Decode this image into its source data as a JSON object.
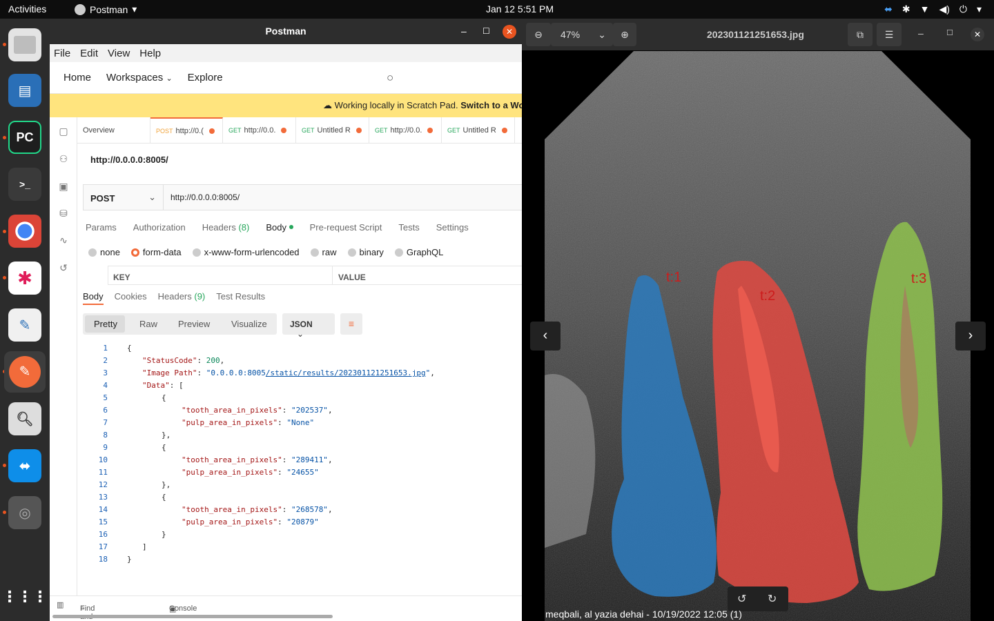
{
  "topbar": {
    "activities": "Activities",
    "app_name": "Postman",
    "clock": "Jan 12  5:51 PM"
  },
  "postman": {
    "window_title": "Postman",
    "menu": [
      "File",
      "Edit",
      "View",
      "Help"
    ],
    "nav": {
      "home": "Home",
      "workspaces": "Workspaces",
      "explore": "Explore"
    },
    "banner": {
      "text": "Working locally in Scratch Pad.",
      "link": "Switch to a Wo"
    },
    "tabs": [
      {
        "label": "Overview"
      },
      {
        "method": "POST",
        "label": "http://0.("
      },
      {
        "method": "GET",
        "label": "http://0.0."
      },
      {
        "method": "GET",
        "label": "Untitled R"
      },
      {
        "method": "GET",
        "label": "http://0.0."
      },
      {
        "method": "GET",
        "label": "Untitled R"
      }
    ],
    "request_name": "http://0.0.0.0:8005/",
    "method": "POST",
    "url": "http://0.0.0.0:8005/",
    "request_tabs": [
      "Params",
      "Authorization",
      "Headers",
      "(8)",
      "Body",
      "Pre-request Script",
      "Tests",
      "Settings"
    ],
    "body_options": [
      "none",
      "form-data",
      "x-www-form-urlencoded",
      "raw",
      "binary",
      "GraphQL"
    ],
    "selected_body_option": "form-data",
    "kv_headers": {
      "key": "KEY",
      "value": "VALUE"
    },
    "response_tabs": [
      "Body",
      "Cookies",
      "Headers",
      "(9)",
      "Test Results"
    ],
    "view_modes": [
      "Pretty",
      "Raw",
      "Preview",
      "Visualize"
    ],
    "format": "JSON",
    "status_bar": {
      "find": "Find and Replace",
      "console": "Console"
    }
  },
  "response_json": {
    "status_key": "\"StatusCode\"",
    "status_value": "200",
    "image_key": "\"Image Path\"",
    "image_host": "\"0.0.0.0:8005",
    "image_path": "/static/results/202301121251653.jpg",
    "image_close": "\"",
    "data_key": "\"Data\"",
    "tooth_key": "\"tooth_area_in_pixels\"",
    "pulp_key": "\"pulp_area_in_pixels\"",
    "items": [
      {
        "tooth": "\"202537\"",
        "pulp": "\"None\""
      },
      {
        "tooth": "\"289411\"",
        "pulp": "\"24655\""
      },
      {
        "tooth": "\"268578\"",
        "pulp": "\"20879\""
      }
    ]
  },
  "viewer": {
    "zoom": "47%",
    "filename": "202301121251653.jpg",
    "labels": [
      "t:1",
      "t:2",
      "t:3"
    ],
    "caption": "meqbali, al yazia dehai -  10/19/2022 12:05 (1)"
  },
  "colors": {
    "accent": "#f26b3a",
    "tooth1": "#2f79b8",
    "tooth2": "#d94a43",
    "tooth3": "#8cbb4f",
    "label": "#cc1c1c"
  }
}
